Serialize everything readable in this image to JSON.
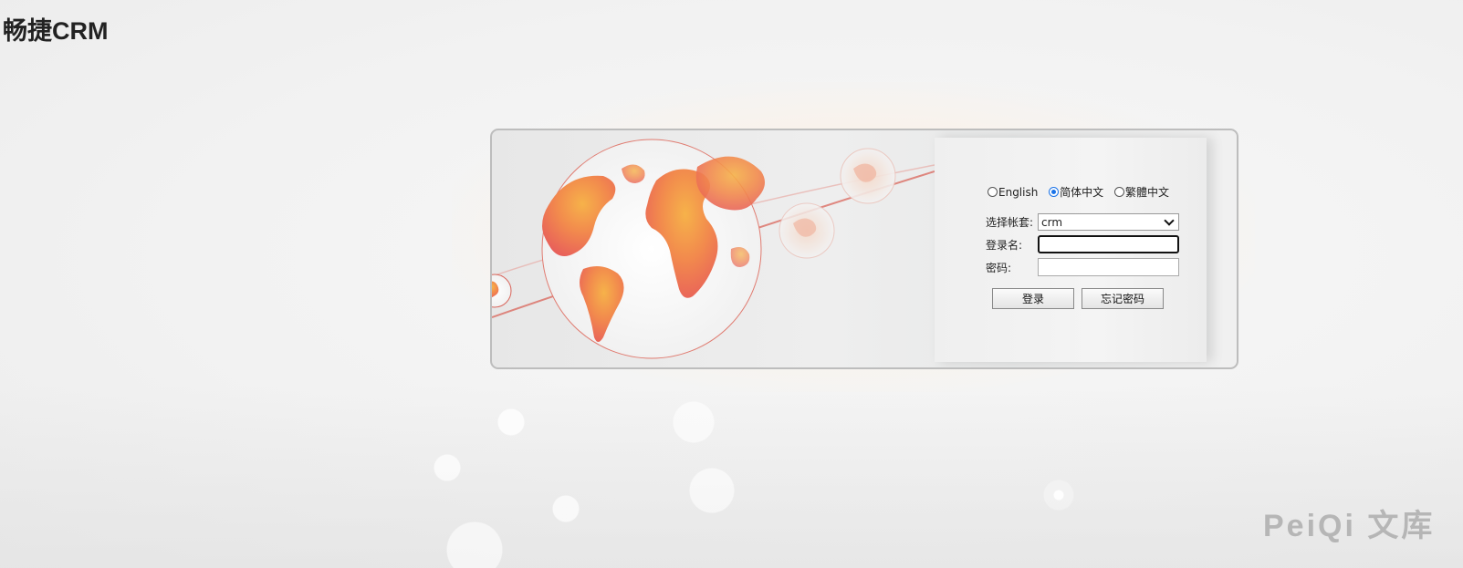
{
  "brand": {
    "logo_text": "畅捷CRM"
  },
  "login": {
    "languages": [
      {
        "label": "English",
        "selected": false
      },
      {
        "label": "简体中文",
        "selected": true
      },
      {
        "label": "繁體中文",
        "selected": false
      }
    ],
    "account_set": {
      "label": "选择帐套:",
      "selected_value": "crm"
    },
    "username": {
      "label": "登录名:",
      "value": "",
      "focused": true
    },
    "password": {
      "label": "密码:",
      "value": ""
    },
    "buttons": {
      "login_label": "登录",
      "forgot_label": "忘记密码"
    }
  },
  "colors": {
    "globe_orange": "#f07a4a",
    "globe_yellow": "#f6b24a",
    "orbit_line": "#d9645a",
    "radio_accent": "#1a73e8"
  },
  "watermark": {
    "text": "PeiQi 文库"
  }
}
